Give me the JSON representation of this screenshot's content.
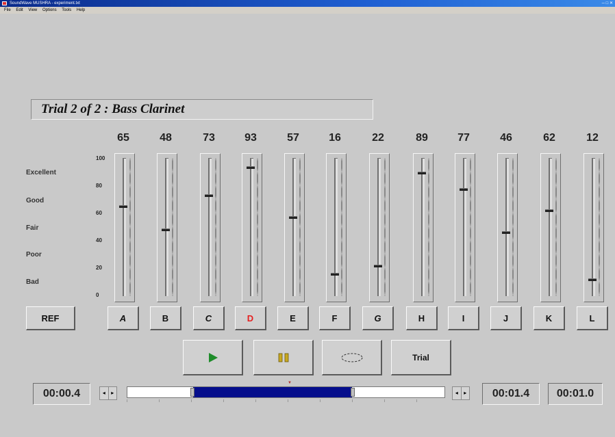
{
  "window": {
    "title": "SoundWave MUSHRA - experiment.txt",
    "controls": "─ □ ✕"
  },
  "menu": [
    "File",
    "Edit",
    "View",
    "Options",
    "Tools",
    "Help"
  ],
  "trial": {
    "title": "Trial 2 of 2 : Bass Clarinet"
  },
  "scale": {
    "grades": [
      "Excellent",
      "Good",
      "Fair",
      "Poor",
      "Bad"
    ],
    "ticks": [
      "100",
      "80",
      "60",
      "40",
      "20",
      "0"
    ]
  },
  "ref_label": "REF",
  "sliders": [
    {
      "letter": "A",
      "value": 65,
      "italic": true
    },
    {
      "letter": "B",
      "value": 48
    },
    {
      "letter": "C",
      "value": 73,
      "italic": true
    },
    {
      "letter": "D",
      "value": 93,
      "active": true
    },
    {
      "letter": "E",
      "value": 57
    },
    {
      "letter": "F",
      "value": 16
    },
    {
      "letter": "G",
      "value": 22,
      "italic": true
    },
    {
      "letter": "H",
      "value": 89
    },
    {
      "letter": "I",
      "value": 77
    },
    {
      "letter": "J",
      "value": 46
    },
    {
      "letter": "K",
      "value": 62
    },
    {
      "letter": "L",
      "value": 12
    }
  ],
  "transport": {
    "play_icon": "play-icon",
    "pause_icon": "pause-icon",
    "loop_icon": "loop-icon",
    "trial_label": "Trial"
  },
  "timeline": {
    "current": "00:00.4",
    "loop_end": "00:01.4",
    "duration": "00:01.0"
  },
  "colors": {
    "background": "#c9c9c9",
    "selection": "#050e8c",
    "active_letter": "#e52020",
    "play": "#1e8c2a",
    "pause": "#c8a820"
  }
}
